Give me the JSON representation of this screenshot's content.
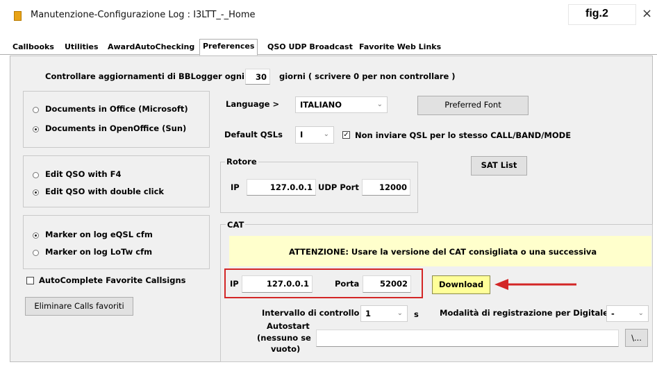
{
  "window": {
    "title": "Manutenzione-Configurazione Log : I3LTT_-_Home",
    "fig_label": "fig.2",
    "close_glyph": "×"
  },
  "tabs": [
    "Callbooks",
    "Utilities",
    "AwardAutoChecking",
    "Preferences",
    "QSO UDP Broadcast",
    "Favorite Web Links"
  ],
  "active_tab": "Preferences",
  "update_check": {
    "label": "Controllare aggiornamenti di BBLogger ogni",
    "value": "30",
    "suffix": "giorni ( scrivere 0 per non controllare )"
  },
  "documents": {
    "option1": "Documents in Office (Microsoft)",
    "option2": "Documents in OpenOffice (Sun)",
    "selected": 2
  },
  "edit_qso": {
    "option1": "Edit QSO with F4",
    "option2": "Edit QSO with double click",
    "selected": 2
  },
  "marker": {
    "option1": "Marker on log eQSL cfm",
    "option2": "Marker on log LoTw cfm",
    "selected": 1
  },
  "autocomplete": {
    "label": "AutoComplete Favorite Callsigns",
    "checked": false
  },
  "remove_favorites_button": "Eliminare Calls favoriti",
  "language": {
    "label": "Language >",
    "value": "ITALIANO"
  },
  "preferred_font_button": "Preferred Font",
  "default_qsls": {
    "label": "Default QSLs",
    "value": "I",
    "checkbox_label": "Non inviare QSL per lo stesso CALL/BAND/MODE",
    "checked": true
  },
  "rotore": {
    "legend": "Rotore",
    "ip_label": "IP",
    "ip_value": "127.0.0.1",
    "udp_label": "UDP Port",
    "udp_value": "12000"
  },
  "sat_list_button": "SAT List",
  "cat": {
    "legend": "CAT",
    "notice": "ATTENZIONE: Usare la versione del CAT consigliata o una successiva",
    "ip_label": "IP",
    "ip_value": "127.0.0.1",
    "porta_label": "Porta",
    "porta_value": "52002",
    "download_button": "Download",
    "interval_label": "Intervallo di controllo",
    "interval_value": "1",
    "interval_unit": "s",
    "digital_mode_label": "Modalità di registrazione per Digitale",
    "digital_mode_value": "-",
    "autostart_label_1": "Autostart",
    "autostart_label_2": "(nessuno se",
    "autostart_label_3": "vuoto)",
    "autostart_value": "",
    "browse_button": "\\..."
  },
  "colors": {
    "highlight_red": "#d32626",
    "notice_yellow": "#ffffcc",
    "download_yellow": "#ffff99"
  }
}
